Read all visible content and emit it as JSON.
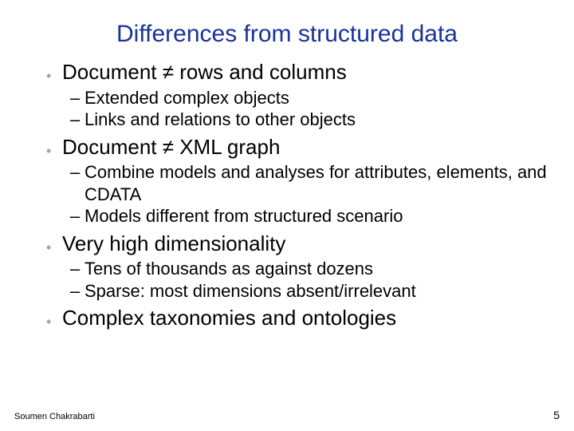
{
  "title": "Differences from structured data",
  "bullets": [
    {
      "text": "Document ≠ rows and columns",
      "subs": [
        "Extended complex objects",
        "Links and relations to other objects"
      ]
    },
    {
      "text": "Document ≠ XML graph",
      "subs": [
        "Combine models and analyses for attributes, elements, and CDATA",
        "Models different from structured scenario"
      ]
    },
    {
      "text": "Very high dimensionality",
      "subs": [
        "Tens of thousands as against dozens",
        "Sparse: most dimensions absent/irrelevant"
      ]
    },
    {
      "text": "Complex taxonomies and ontologies",
      "subs": []
    }
  ],
  "footer_author": "Soumen Chakrabarti",
  "footer_page": "5"
}
